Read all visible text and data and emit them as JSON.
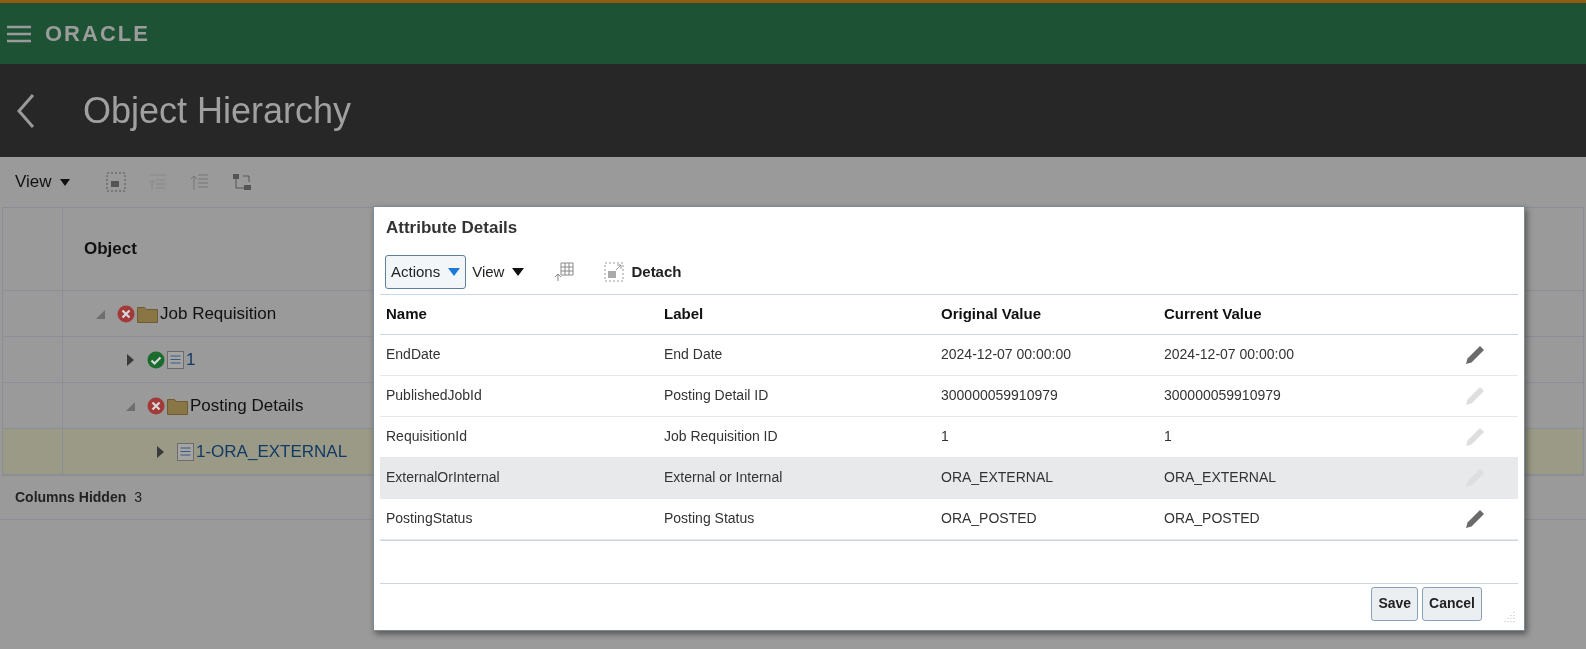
{
  "header": {
    "brand": "ORACLE"
  },
  "page": {
    "title": "Object Hierarchy"
  },
  "toolbar": {
    "view_menu": "View"
  },
  "tree_table": {
    "column": "Object",
    "rows": [
      {
        "label": "Job Requisition",
        "status": {
          "kind": "error"
        },
        "kind": "folder",
        "expanded": true,
        "selected": false,
        "children": [
          {
            "label": "1",
            "status": {
              "kind": "valid"
            },
            "kind": "document",
            "expanded": false,
            "selected": false
          },
          {
            "label": "Posting Details",
            "status": {
              "kind": "error"
            },
            "kind": "folder",
            "expanded": true,
            "selected": false,
            "children": [
              {
                "label": "1-ORA_EXTERNAL",
                "kind": "document",
                "expanded": false,
                "selected": true
              }
            ]
          }
        ]
      }
    ]
  },
  "columns_hidden": {
    "label": "Columns Hidden",
    "count": "3"
  },
  "dialog": {
    "title": "Attribute Details",
    "actions_menu": "Actions",
    "view_menu": "View",
    "detach": "Detach",
    "columns": [
      "Name",
      "Label",
      "Original Value",
      "Current Value"
    ],
    "rows": [
      {
        "cells": [
          "EndDate",
          "End Date",
          "2024-12-07 00:00:00",
          "2024-12-07 00:00:00"
        ],
        "editable": true,
        "selected": false
      },
      {
        "cells": [
          "PublishedJobId",
          "Posting Detail ID",
          "300000059910979",
          "300000059910979"
        ],
        "editable": false,
        "selected": false
      },
      {
        "cells": [
          "RequisitionId",
          "Job Requisition ID",
          "1",
          "1"
        ],
        "editable": false,
        "selected": false
      },
      {
        "cells": [
          "ExternalOrInternal",
          "External or Internal",
          "ORA_EXTERNAL",
          "ORA_EXTERNAL"
        ],
        "editable": false,
        "selected": true
      },
      {
        "cells": [
          "PostingStatus",
          "Posting Status",
          "ORA_POSTED",
          "ORA_POSTED"
        ],
        "editable": true,
        "selected": false
      }
    ],
    "buttons": [
      "Save",
      "Cancel"
    ]
  }
}
